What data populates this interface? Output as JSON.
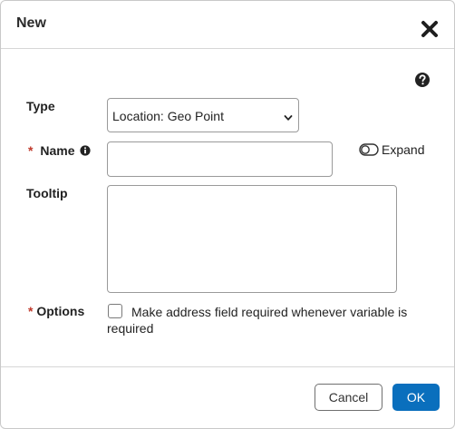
{
  "dialog": {
    "title": "New",
    "close_icon": "close-icon",
    "help_icon": "help-icon"
  },
  "form": {
    "type": {
      "label": "Type",
      "selected": "Location: Geo Point"
    },
    "name": {
      "required_marker": "*",
      "label": "Name",
      "info_icon": "info-icon",
      "value": "",
      "placeholder": ""
    },
    "expand": {
      "label": "Expand",
      "toggle_icon": "toggle-off-icon"
    },
    "tooltip": {
      "label": "Tooltip",
      "value": ""
    },
    "options": {
      "required_marker": "*",
      "label": "Options",
      "checkbox_label": "Make address field required whenever variable is required",
      "checked": false
    }
  },
  "footer": {
    "cancel_label": "Cancel",
    "ok_label": "OK"
  },
  "colors": {
    "primary": "#0a6fbd",
    "required": "#c0392b",
    "border": "#9a9a9a"
  }
}
